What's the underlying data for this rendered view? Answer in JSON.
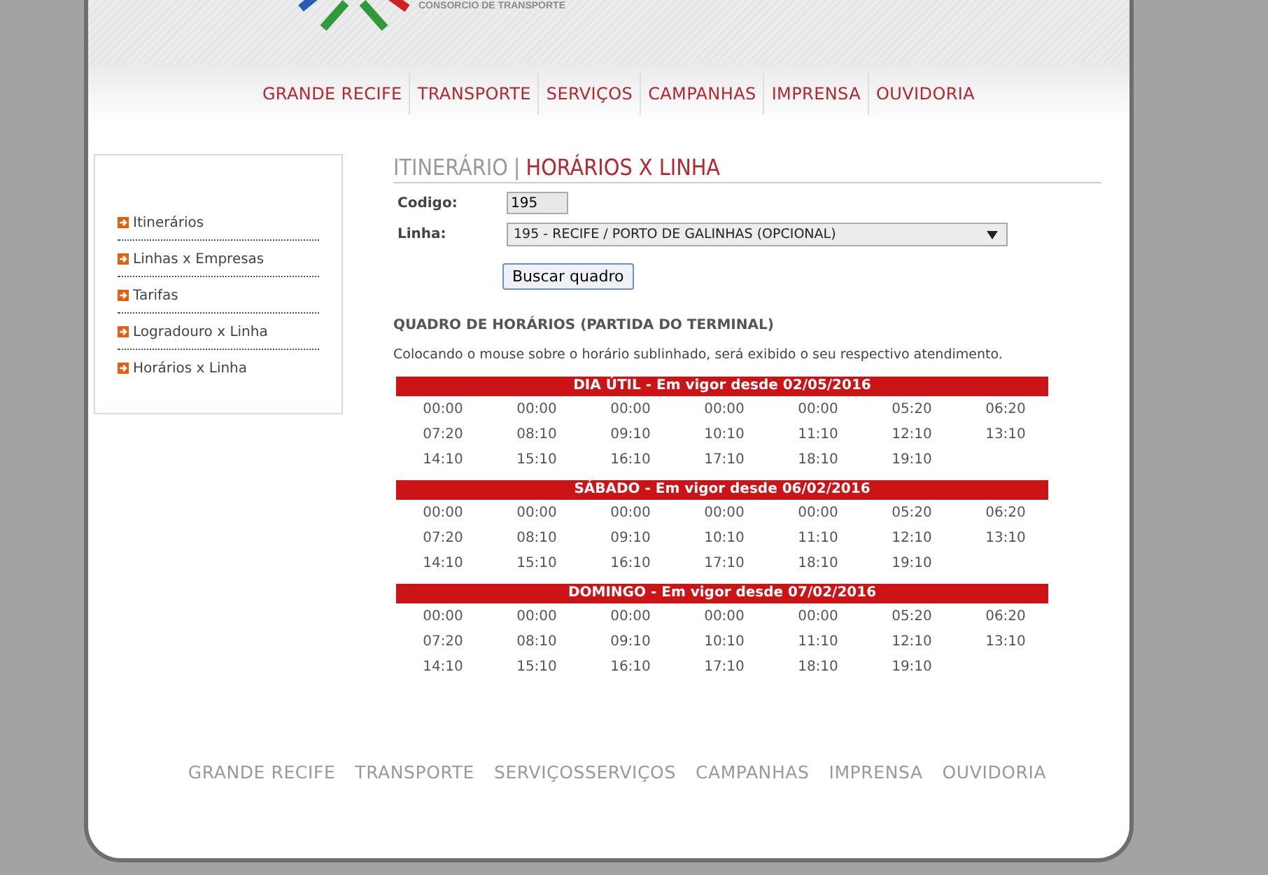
{
  "logo": {
    "subtitle": "CONSORCIO DE TRANSPORTE"
  },
  "nav": [
    "GRANDE RECIFE",
    "TRANSPORTE",
    "SERVIÇOS",
    "CAMPANHAS",
    "IMPRENSA",
    "OUVIDORIA"
  ],
  "sidebar": {
    "items": [
      "Itinerários",
      "Linhas x Empresas",
      "Tarifas",
      "Logradouro x Linha",
      "Horários x Linha"
    ]
  },
  "title": {
    "section": "ITINERÁRIO",
    "separator": "|",
    "page": "HORÁRIOS X LINHA"
  },
  "form": {
    "codigo_label": "Codigo:",
    "codigo_value": "195",
    "linha_label": "Linha:",
    "linha_value": "195 - RECIFE / PORTO DE GALINHAS (OPCIONAL)",
    "button": "Buscar quadro"
  },
  "schedule_heading": "QUADRO DE HORÁRIOS (PARTIDA DO TERMINAL)",
  "hint": "Colocando o mouse sobre o horário sublinhado, será exibido o seu respectivo atendimento.",
  "schedules": [
    {
      "title": "DIA ÚTIL - Em vigor desde 02/05/2016",
      "times": [
        "00:00",
        "00:00",
        "00:00",
        "00:00",
        "00:00",
        "05:20",
        "06:20",
        "07:20",
        "08:10",
        "09:10",
        "10:10",
        "11:10",
        "12:10",
        "13:10",
        "14:10",
        "15:10",
        "16:10",
        "17:10",
        "18:10",
        "19:10"
      ]
    },
    {
      "title": "SÁBADO - Em vigor desde 06/02/2016",
      "times": [
        "00:00",
        "00:00",
        "00:00",
        "00:00",
        "00:00",
        "05:20",
        "06:20",
        "07:20",
        "08:10",
        "09:10",
        "10:10",
        "11:10",
        "12:10",
        "13:10",
        "14:10",
        "15:10",
        "16:10",
        "17:10",
        "18:10",
        "19:10"
      ]
    },
    {
      "title": "DOMINGO - Em vigor desde 07/02/2016",
      "times": [
        "00:00",
        "00:00",
        "00:00",
        "00:00",
        "00:00",
        "05:20",
        "06:20",
        "07:20",
        "08:10",
        "09:10",
        "10:10",
        "11:10",
        "12:10",
        "13:10",
        "14:10",
        "15:10",
        "16:10",
        "17:10",
        "18:10",
        "19:10"
      ]
    }
  ],
  "footer_nav": [
    "GRANDE RECIFE",
    "TRANSPORTE",
    "SERVIÇOSSERVIÇOS",
    "CAMPANHAS",
    "IMPRENSA",
    "OUVIDORIA"
  ]
}
